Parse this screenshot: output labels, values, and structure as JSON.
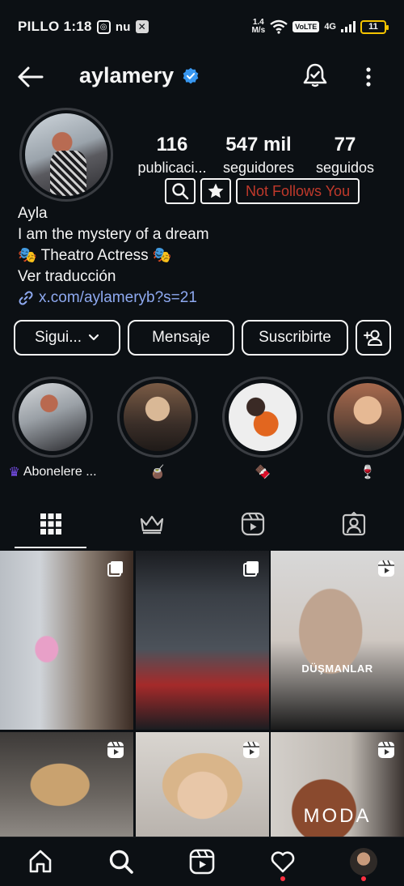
{
  "status_bar": {
    "carrier_time": "PILLO 1:18",
    "nu_label": "nu",
    "speed": "1.4",
    "speed_unit": "M/s",
    "volte": "VoLTE",
    "network": "4G",
    "battery": "11"
  },
  "header": {
    "username": "aylamery"
  },
  "profile": {
    "stats": [
      {
        "value": "116",
        "label": "publicaci..."
      },
      {
        "value": "547 mil",
        "label": "seguidores"
      },
      {
        "value": "77",
        "label": "seguidos"
      }
    ],
    "not_follows_label": "Not Follows You",
    "name": "Ayla",
    "bio_line1": "I am the mystery of a dream",
    "bio_line2": "🎭  Theatro  Actress 🎭",
    "translate": "Ver traducción",
    "link": "x.com/aylameryb?s=21"
  },
  "actions": {
    "follow_label": "Sigui...",
    "message_label": "Mensaje",
    "subscribe_label": "Suscribirte"
  },
  "highlights": [
    {
      "label": "Abonelere ...",
      "crown": true,
      "colors": [
        "#d6d9dc",
        "#6b6e73",
        "#2a2a2e"
      ]
    },
    {
      "label": "🧉",
      "crown": false,
      "colors": [
        "#d9b896",
        "#7a5b45",
        "#1f1a18"
      ]
    },
    {
      "label": "🍫",
      "crown": false,
      "colors": [
        "#f2f2f2",
        "#e2661f",
        "#3a2a25"
      ]
    },
    {
      "label": "🍷",
      "crown": false,
      "colors": [
        "#e6b994",
        "#a86a4e",
        "#2a2a2a"
      ]
    }
  ],
  "grid": {
    "posts": [
      {
        "type": "carousel",
        "overlay": "",
        "colors": [
          "#cfd3d8",
          "#8a7d72",
          "#e8a0c8"
        ]
      },
      {
        "type": "carousel",
        "overlay": "",
        "colors": [
          "#3a3f46",
          "#a52a2a",
          "#1b1d21"
        ]
      },
      {
        "type": "reel",
        "overlay": "DÜŞMANLAR",
        "colors": [
          "#d8d8d8",
          "#bfa490",
          "#1a1a1a"
        ]
      },
      {
        "type": "reel",
        "overlay": "",
        "colors": [
          "#3d3a38",
          "#c9a26f",
          "#8f8a85"
        ]
      },
      {
        "type": "reel",
        "overlay": "",
        "colors": [
          "#d9d5d0",
          "#d9b58a",
          "#b9b3ad"
        ]
      },
      {
        "type": "reel",
        "overlay": "MODA",
        "colors": [
          "#d3cfca",
          "#8a4a2e",
          "#3a3330"
        ]
      }
    ]
  },
  "colors": {
    "background": "#0c1014",
    "link": "#8ea9f0",
    "not_follows": "#c0392b",
    "verified": "#3897f0",
    "notification_dot": "#ff3040"
  }
}
